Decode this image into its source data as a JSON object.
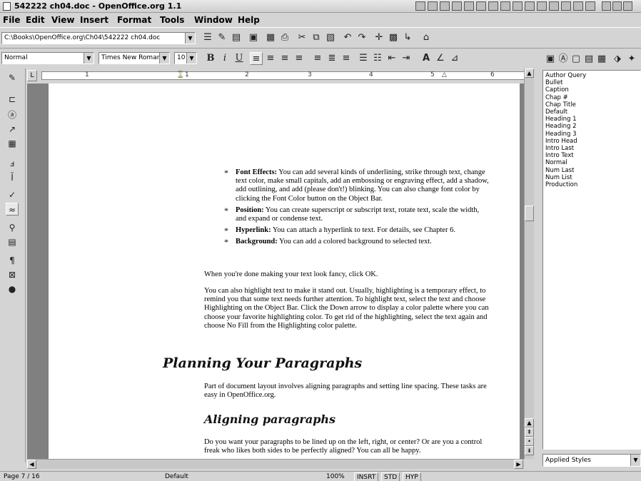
{
  "window": {
    "title": "542222 ch04.doc - OpenOffice.org 1.1"
  },
  "menu": [
    "File",
    "Edit",
    "View",
    "Insert",
    "Format",
    "Tools",
    "Window",
    "Help"
  ],
  "toolbar": {
    "path": "C:\\Books\\OpenOffice.org\\Ch04\\542222 ch04.doc"
  },
  "format": {
    "style": "Normal",
    "font": "Times New Roman",
    "size": "10"
  },
  "ruler": {
    "marks": [
      "1",
      "1",
      "2",
      "3",
      "4",
      "5",
      "6"
    ]
  },
  "document": {
    "bullets": [
      {
        "term": "Font Effects:",
        "text": " You can add several kinds of underlining, strike through text, change text color, make small capitals, add an embossing or engraving effect, add a shadow, add outlining, and add (please don't!) blinking. You can also change font color by clicking the Font Color button on the Object Bar."
      },
      {
        "term": "Position:",
        "text": " You can create superscript or subscript text, rotate text, scale the width, and expand or condense text."
      },
      {
        "term": "Hyperlink:",
        "text": " You can attach a hyperlink to text. For details, see Chapter 6."
      },
      {
        "term": "Background:",
        "text": " You can add a colored background to selected text."
      }
    ],
    "done_para": "When you're done making your text look fancy, click OK.",
    "highlight_para": "You can also highlight text to make it stand out. Usually, highlighting is a temporary effect, to remind you that some text needs further attention. To highlight text, select the text and choose Highlighting on the Object Bar. Click the Down arrow to display a color palette where you can choose your favorite highlighting color. To get rid of the highlighting, select the text again and choose No Fill from the Highlighting color palette.",
    "heading1": "Planning Your Paragraphs",
    "layout_para": "Part of document layout involves aligning paragraphs and setting line spacing. These tasks are easy in OpenOffice.org.",
    "heading2": "Aligning paragraphs",
    "align_para": "Do you want your paragraphs to be lined up on the left, right, or center? Or are you a control freak who likes both sides to be perfectly aligned? You can all be happy."
  },
  "stylist": {
    "styles": [
      "Author Query",
      "Bullet",
      "Caption",
      "Chap #",
      "Chap Title",
      "Default",
      "Heading 1",
      "Heading 2",
      "Heading 3",
      "Intro Head",
      "Intro Last",
      "Intro Text",
      "Normal",
      "Num Last",
      "Num List",
      "Production"
    ],
    "filter": "Applied Styles"
  },
  "status": {
    "page": "Page 7 / 16",
    "page_style": "Default",
    "zoom": "100%",
    "insert": "INSRT",
    "std": "STD",
    "hyp": "HYP"
  }
}
